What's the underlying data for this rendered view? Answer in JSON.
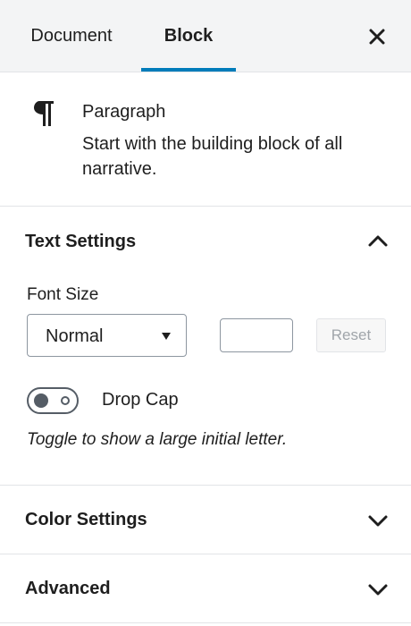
{
  "tabs": {
    "document": "Document",
    "block": "Block"
  },
  "block_card": {
    "title": "Paragraph",
    "description": "Start with the building block of all narrative."
  },
  "text_settings": {
    "title": "Text Settings",
    "font_size_label": "Font Size",
    "font_size_selected": "Normal",
    "custom_size_value": "",
    "reset_label": "Reset",
    "drop_cap_label": "Drop Cap",
    "drop_cap_help": "Toggle to show a large initial letter."
  },
  "color_settings": {
    "title": "Color Settings"
  },
  "advanced": {
    "title": "Advanced"
  },
  "icons": {
    "close": "close-icon",
    "block": "paragraph-icon",
    "expanded": "chevron-up-icon",
    "collapsed": "chevron-down-icon"
  },
  "colors": {
    "accent": "#007cba",
    "border": "#e2e4e7",
    "header_bg": "#f3f4f5"
  }
}
